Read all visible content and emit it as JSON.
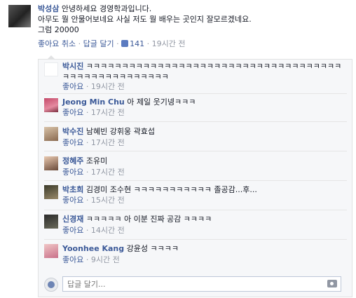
{
  "post": {
    "author": "박성삼",
    "text_line1": " 안녕하세요 경영학과입니다.",
    "text_line2": "아무도 뭘 안물어보네요 사실 저도 뭘 배우는 곳인지 잘모르겠네요.",
    "text_line3": "그럼 20000",
    "like_cancel": "좋아요 취소",
    "reply": "답글 달기",
    "like_count": "141",
    "time": "19시간 전",
    "sep": " · "
  },
  "comments": [
    {
      "author": "박시진",
      "text": " ㅋㅋㅋㅋㅋㅋㅋㅋㅋㅋㅋㅋㅋㅋㅋㅋㅋㅋㅋㅋㅋㅋㅋㅋㅋㅋㅋㅋㅋㅋㅋㅋㅋㅋㅋㅋㅋㅋㅋㅋㅋㅋㅋㅋㅋㅋㅋㅋㅋㅋㅋ",
      "like": "좋아요",
      "time": "19시간 전"
    },
    {
      "author": "Jeong Min Chu",
      "text": " 아 제일 웃기넹ㅋㅋㅋ",
      "like": "좋아요",
      "time": "17시간 전"
    },
    {
      "author": "박수진",
      "text": " 남혜빈 강휘웅 곽효섭",
      "like": "좋아요",
      "time": "17시간 전"
    },
    {
      "author": "정혜주",
      "text": " 조유미",
      "like": "좋아요",
      "time": "17시간 전"
    },
    {
      "author": "박초희",
      "text": " 김경미 조수현 ㅋㅋㅋㅋㅋㅋㅋㅋㅋㅋㅋ 졸공감...후...",
      "like": "좋아요",
      "time": "15시간 전"
    },
    {
      "author": "신경재",
      "text": " ㅋㅋㅋㅋㅋ 아 이분 진짜 공감 ㅋㅋㅋㅋ",
      "like": "좋아요",
      "time": "14시간 전"
    },
    {
      "author": "Yoonhee Kang",
      "text": " 강윤성 ㅋㅋㅋㅋ",
      "like": "좋아요",
      "time": "9시간 전"
    }
  ],
  "reply_box": {
    "placeholder": "답글 달기..."
  },
  "icons": {
    "like": "thumbs-up-icon",
    "camera": "camera-icon",
    "avatar": "user-avatar-icon"
  },
  "colors": {
    "link": "#3b5998",
    "meta": "#9197a3",
    "panel": "#f6f7f9"
  }
}
